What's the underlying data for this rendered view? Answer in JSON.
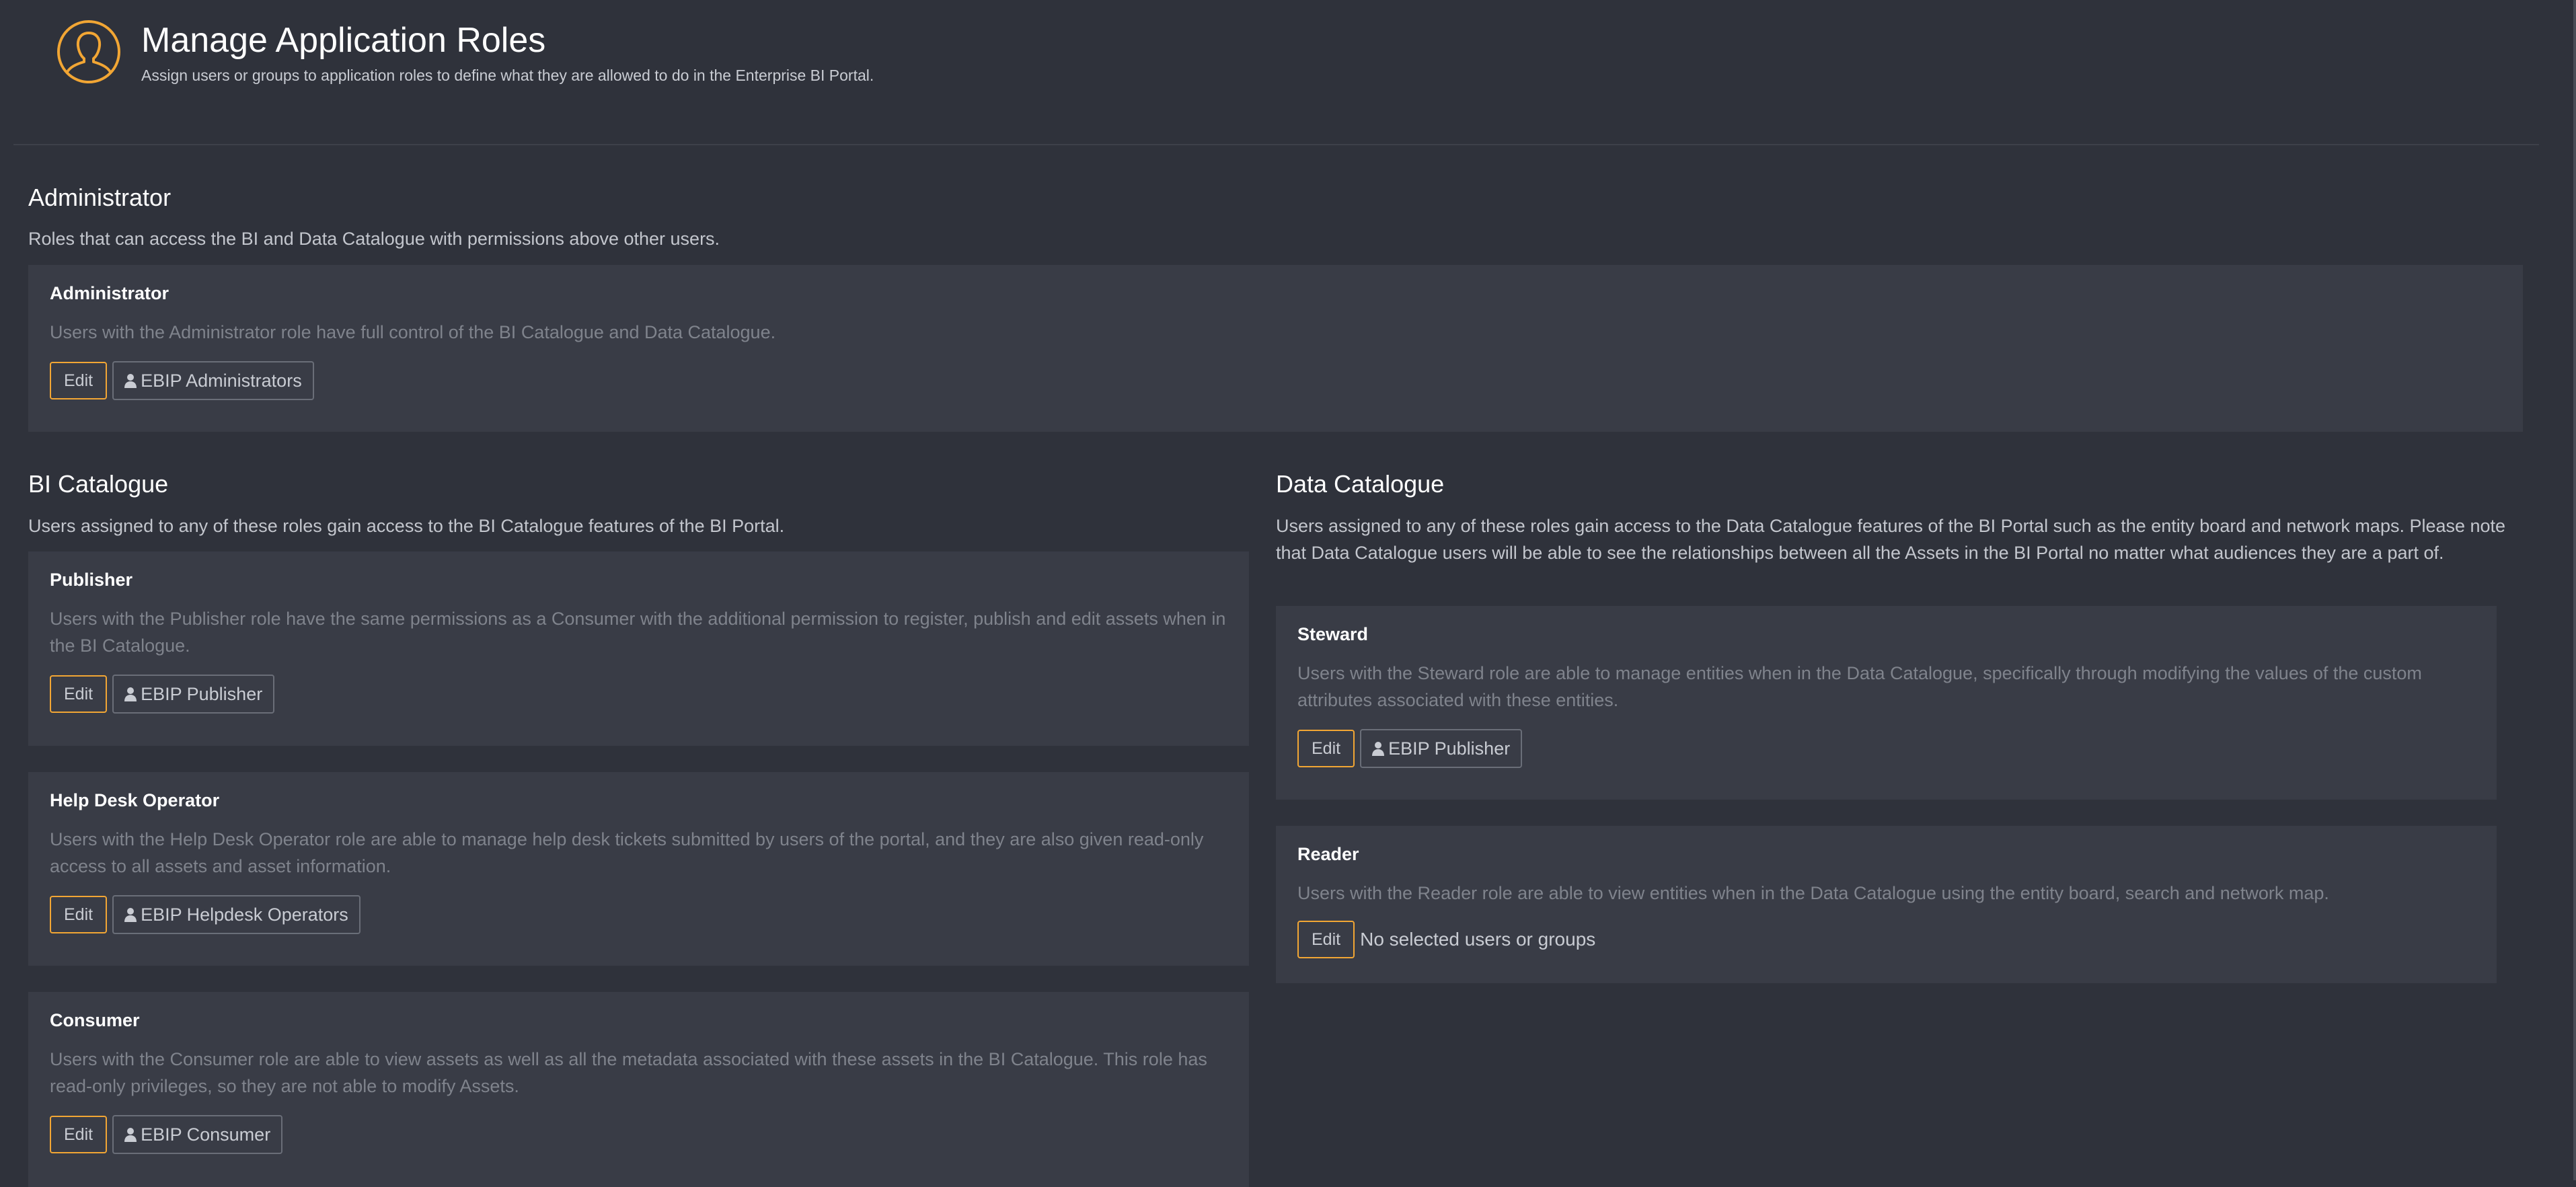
{
  "header": {
    "icon": "user-circle-icon",
    "title": "Manage Application Roles",
    "subtitle": "Assign users or groups to application roles to define what they are allowed to do in the Enterprise BI Portal."
  },
  "colors": {
    "background": "#2f323b",
    "card": "#393c46",
    "accent": "#f2a634"
  },
  "administrator_section": {
    "title": "Administrator",
    "description": "Roles that can access the BI and Data Catalogue with permissions above other users.",
    "roles": [
      {
        "name": "Administrator",
        "description": "Users with the Administrator role have full control of the BI Catalogue and Data Catalogue.",
        "edit_label": "Edit",
        "groups": [
          "EBIP Administrators"
        ]
      }
    ]
  },
  "bi_catalogue": {
    "title": "BI Catalogue",
    "description": "Users assigned to any of these roles gain access to the BI Catalogue features of the BI Portal.",
    "roles": [
      {
        "name": "Publisher",
        "description": "Users with the Publisher role have the same permissions as a Consumer with the additional permission to register, publish and edit assets when in the BI Catalogue.",
        "edit_label": "Edit",
        "groups": [
          "EBIP Publisher"
        ]
      },
      {
        "name": "Help Desk Operator",
        "description": "Users with the Help Desk Operator role are able to manage help desk tickets submitted by users of the portal, and they are also given read-only access to all assets and asset information.",
        "edit_label": "Edit",
        "groups": [
          "EBIP Helpdesk Operators"
        ]
      },
      {
        "name": "Consumer",
        "description": "Users with the Consumer role are able to view assets as well as all the metadata associated with these assets in the BI Catalogue. This role has read-only privileges, so they are not able to modify Assets.",
        "edit_label": "Edit",
        "groups": [
          "EBIP Consumer"
        ]
      }
    ]
  },
  "data_catalogue": {
    "title": "Data Catalogue",
    "description": "Users assigned to any of these roles gain access to the Data Catalogue features of the BI Portal such as the entity board and network maps. Please note that Data Catalogue users will be able to see the relationships between all the Assets in the BI Portal no matter what audiences they are a part of.",
    "roles": [
      {
        "name": "Steward",
        "description": "Users with the Steward role are able to manage entities when in the Data Catalogue, specifically through modifying the values of the custom attributes associated with these entities.",
        "edit_label": "Edit",
        "groups": [
          "EBIP Publisher"
        ]
      },
      {
        "name": "Reader",
        "description": "Users with the Reader role are able to view entities when in the Data Catalogue using the entity board, search and network map.",
        "edit_label": "Edit",
        "groups": [],
        "empty_text": "No selected users or groups"
      }
    ]
  }
}
